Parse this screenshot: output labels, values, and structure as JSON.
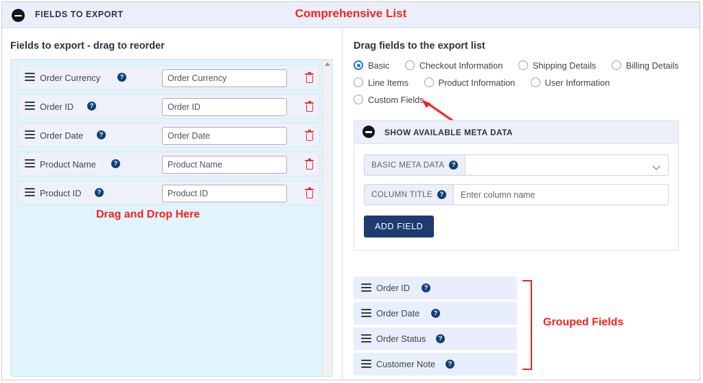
{
  "header": {
    "title": "FIELDS TO EXPORT",
    "collapse_icon": "minus-circle-icon",
    "annotation": "Comprehensive List",
    "annotation_color": "#fa2020",
    "background": "#eaeffa"
  },
  "left_panel": {
    "heading": "Fields to export - drag to reorder",
    "dropzone_color": "#dff4fb",
    "annotation": "Drag and Drop Here",
    "fields": [
      {
        "label": "Order Currency",
        "value": "Order Currency"
      },
      {
        "label": "Order ID",
        "value": "Order ID"
      },
      {
        "label": "Order Date",
        "value": "Order Date"
      },
      {
        "label": "Product Name",
        "value": "Product Name"
      },
      {
        "label": "Product ID",
        "value": "Product ID"
      }
    ]
  },
  "right_panel": {
    "heading": "Drag fields to the export list",
    "radio_groups": [
      [
        {
          "label": "Basic",
          "checked": true
        },
        {
          "label": "Checkout Information",
          "checked": false
        },
        {
          "label": "Shipping Details",
          "checked": false
        },
        {
          "label": "Billing Details",
          "checked": false
        }
      ],
      [
        {
          "label": "Line Items",
          "checked": false
        },
        {
          "label": "Product Information",
          "checked": false
        },
        {
          "label": "User Information",
          "checked": false
        }
      ],
      [
        {
          "label": "Custom Fields",
          "checked": false
        }
      ]
    ],
    "meta_card": {
      "title": "SHOW AVAILABLE META DATA",
      "collapse_icon": "minus-circle-icon",
      "meta_select_label": "BASIC META DATA",
      "meta_select_value": "",
      "column_title_label": "COLUMN TITLE",
      "column_title_placeholder": "Enter column name",
      "column_title_value": "",
      "add_button": "ADD FIELD",
      "add_button_color": "#1e3a70"
    },
    "grouped_fields": [
      {
        "label": "Order ID"
      },
      {
        "label": "Order Date"
      },
      {
        "label": "Order Status"
      },
      {
        "label": "Customer Note"
      }
    ],
    "grouped_annotation": "Grouped Fields"
  },
  "icons": {
    "help": "?",
    "drag_handle": "hamburger-drag-icon",
    "trash": "trash-icon"
  }
}
